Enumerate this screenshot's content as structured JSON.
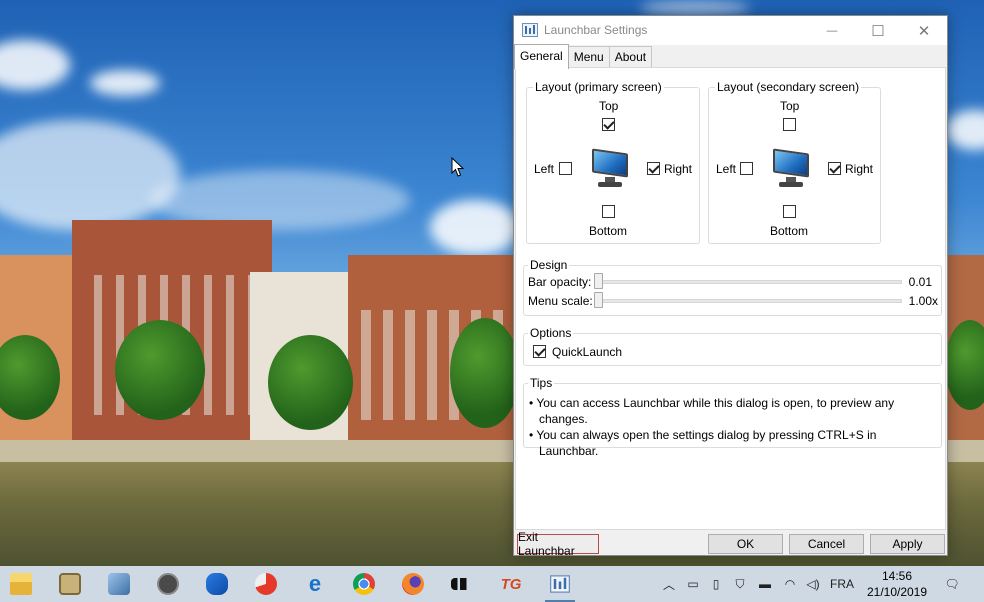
{
  "window": {
    "title": "Launchbar Settings",
    "controls": {
      "minimize": "—",
      "maximize": "☐",
      "close": "✕"
    }
  },
  "tabs": [
    "General",
    "Menu",
    "About"
  ],
  "active_tab": "General",
  "layout_primary": {
    "title": "Layout (primary screen)",
    "top": {
      "label": "Top",
      "checked": true
    },
    "left": {
      "label": "Left",
      "checked": false
    },
    "right": {
      "label": "Right",
      "checked": true
    },
    "bottom": {
      "label": "Bottom",
      "checked": false
    }
  },
  "layout_secondary": {
    "title": "Layout (secondary screen)",
    "top": {
      "label": "Top",
      "checked": false
    },
    "left": {
      "label": "Left",
      "checked": false
    },
    "right": {
      "label": "Right",
      "checked": true
    },
    "bottom": {
      "label": "Bottom",
      "checked": false
    }
  },
  "design": {
    "title": "Design",
    "bar_opacity": {
      "label": "Bar opacity:",
      "value": "0.01",
      "level": 0.0
    },
    "menu_scale": {
      "label": "Menu scale:",
      "value": "1.00x",
      "level": 0.0
    }
  },
  "options": {
    "title": "Options",
    "quicklaunch": {
      "label": "QuickLaunch",
      "checked": true
    }
  },
  "tips": {
    "title": "Tips",
    "items": [
      "• You can access Launchbar while this dialog is open, to preview any changes.",
      "• You can always open the settings dialog by pressing CTRL+S in Launchbar."
    ]
  },
  "buttons": {
    "exit": "Exit Launchbar",
    "ok": "OK",
    "cancel": "Cancel",
    "apply": "Apply"
  },
  "taskbar": {
    "apps": [
      "file-explorer",
      "app-2",
      "app-3",
      "app-4",
      "malwarebytes",
      "ccleaner",
      "edge",
      "chrome",
      "firefox",
      "app-10",
      "tg",
      "launchbar"
    ],
    "tg_label": "TG",
    "tray": {
      "language": "FRA",
      "time": "14:56",
      "date": "21/10/2019"
    }
  }
}
